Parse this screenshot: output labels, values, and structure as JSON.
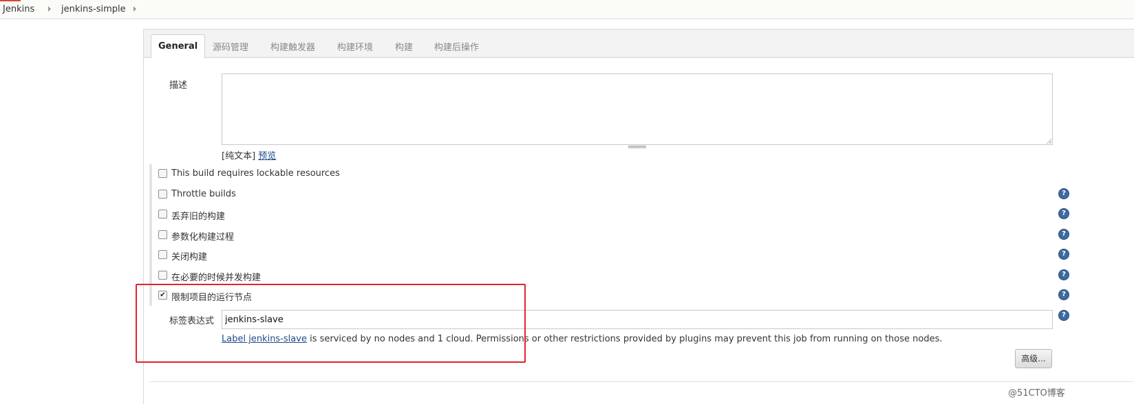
{
  "breadcrumb": {
    "items": [
      "Jenkins",
      "jenkins-simple"
    ]
  },
  "tabs": [
    {
      "label": "General",
      "active": true
    },
    {
      "label": "源码管理"
    },
    {
      "label": "构建触发器"
    },
    {
      "label": "构建环境"
    },
    {
      "label": "构建"
    },
    {
      "label": "构建后操作"
    }
  ],
  "description": {
    "label": "描述",
    "value": "",
    "plain_text": "[纯文本]",
    "preview": "预览"
  },
  "options": [
    {
      "label": "This build requires lockable resources",
      "checked": false,
      "help": false
    },
    {
      "label": "Throttle builds",
      "checked": false,
      "help": true
    },
    {
      "label": "丢弃旧的构建",
      "checked": false,
      "help": true
    },
    {
      "label": "参数化构建过程",
      "checked": false,
      "help": true
    },
    {
      "label": "关闭构建",
      "checked": false,
      "help": true
    },
    {
      "label": "在必要的时候并发构建",
      "checked": false,
      "help": true
    },
    {
      "label": "限制项目的运行节点",
      "checked": true,
      "help": true
    }
  ],
  "label_expression": {
    "label": "标签表达式",
    "value": "jenkins-slave",
    "info_link": "Label jenkins-slave",
    "info_text": " is serviced by no nodes and 1 cloud. Permissions or other restrictions provided by plugins may prevent this job from running on those nodes."
  },
  "advanced_button": "高级...",
  "help_glyph": "?",
  "check_glyph": "✔",
  "watermark": "@51CTO博客",
  "colors": {
    "highlight": "#e0232a",
    "link": "#204a87",
    "help": "#3d6aa0"
  }
}
